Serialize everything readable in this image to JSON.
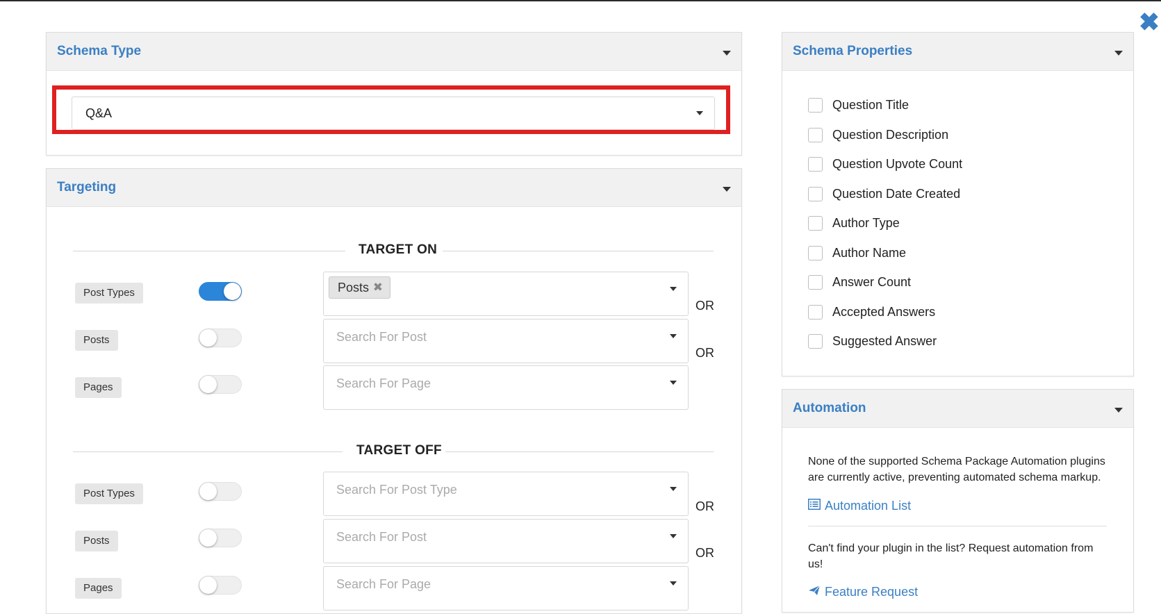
{
  "close_label": "✖",
  "schema_type": {
    "title": "Schema Type",
    "selected": "Q&A"
  },
  "targeting": {
    "title": "Targeting",
    "target_on": {
      "heading": "TARGET ON",
      "rows": [
        {
          "label": "Post Types",
          "toggle_on": true,
          "chip": "Posts",
          "placeholder": "",
          "or": "OR"
        },
        {
          "label": "Posts",
          "toggle_on": false,
          "placeholder": "Search For Post",
          "or": "OR"
        },
        {
          "label": "Pages",
          "toggle_on": false,
          "placeholder": "Search For Page",
          "or": ""
        }
      ]
    },
    "target_off": {
      "heading": "TARGET OFF",
      "rows": [
        {
          "label": "Post Types",
          "toggle_on": false,
          "placeholder": "Search For Post Type",
          "or": "OR"
        },
        {
          "label": "Posts",
          "toggle_on": false,
          "placeholder": "Search For Post",
          "or": "OR"
        },
        {
          "label": "Pages",
          "toggle_on": false,
          "placeholder": "Search For Page",
          "or": ""
        }
      ]
    }
  },
  "schema_properties": {
    "title": "Schema Properties",
    "items": [
      "Question Title",
      "Question Description",
      "Question Upvote Count",
      "Question Date Created",
      "Author Type",
      "Author Name",
      "Answer Count",
      "Accepted Answers",
      "Suggested Answer"
    ]
  },
  "automation": {
    "title": "Automation",
    "message": "None of the supported Schema Package Automation plugins are currently active, preventing automated schema markup.",
    "list_link": "Automation List",
    "request_text": "Can't find your plugin in the list? Request automation from us!",
    "request_link": "Feature Request"
  },
  "colors": {
    "accent": "#3a7fc4",
    "highlight": "#e02020",
    "toggle_on": "#2b85d8"
  }
}
